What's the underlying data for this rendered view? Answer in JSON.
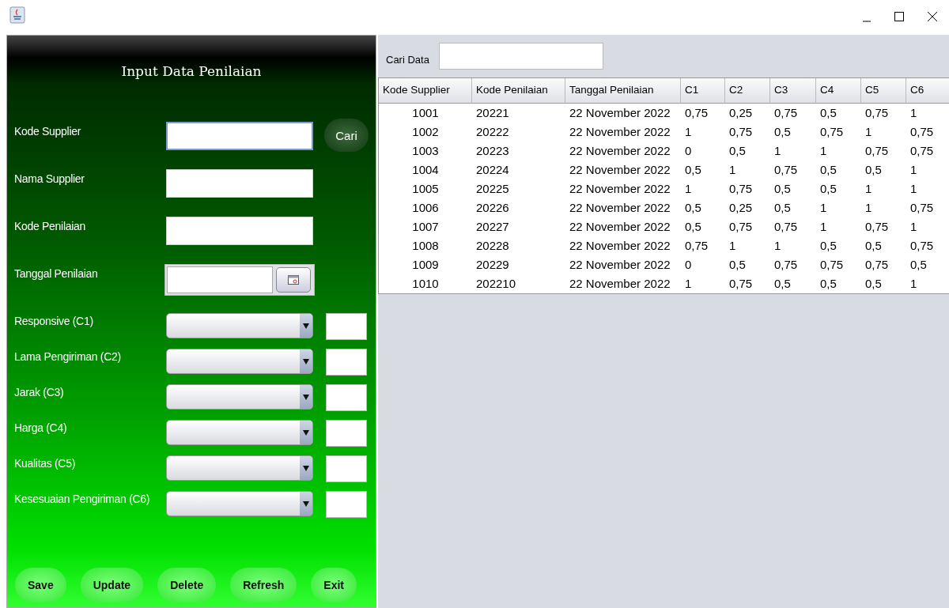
{
  "form": {
    "title": "Input Data Penilaian",
    "fields": [
      {
        "kind": "text",
        "label": "Kode Supplier",
        "focused": true,
        "action": "Cari"
      },
      {
        "kind": "text",
        "label": "Nama Supplier",
        "focused": false
      },
      {
        "kind": "text",
        "label": "Kode Penilaian",
        "focused": false
      },
      {
        "kind": "date",
        "label": "Tanggal Penilaian",
        "focused": false
      },
      {
        "kind": "combo",
        "label": "Responsive (C1)",
        "focused": false
      },
      {
        "kind": "combo",
        "label": "Lama Pengiriman (C2)",
        "focused": false
      },
      {
        "kind": "combo",
        "label": "Jarak (C3)",
        "focused": false
      },
      {
        "kind": "combo",
        "label": "Harga (C4)",
        "focused": false
      },
      {
        "kind": "combo",
        "label": "Kualitas (C5)",
        "focused": false
      },
      {
        "kind": "combo",
        "label": "Kesesuaian Pengiriman (C6)",
        "focused": false
      }
    ],
    "buttons": [
      "Save",
      "Update",
      "Delete",
      "Refresh",
      "Exit"
    ]
  },
  "search": {
    "label": "Cari Data"
  },
  "table": {
    "columns": [
      "Kode Supplier",
      "Kode Penilaian",
      "Tanggal Penilaian",
      "C1",
      "C2",
      "C3",
      "C4",
      "C5",
      "C6"
    ],
    "rows": [
      [
        "1001",
        "20221",
        "22 November 2022",
        "0,75",
        "0,25",
        "0,75",
        "0,5",
        "0,75",
        "1"
      ],
      [
        "1002",
        "20222",
        "22 November 2022",
        "1",
        "0,75",
        "0,5",
        "0,75",
        "1",
        "0,75"
      ],
      [
        "1003",
        "20223",
        "22 November 2022",
        "0",
        "0,5",
        "1",
        "1",
        "0,75",
        "0,75"
      ],
      [
        "1004",
        "20224",
        "22 November 2022",
        "0,5",
        "1",
        "0,75",
        "0,5",
        "0,5",
        "1"
      ],
      [
        "1005",
        "20225",
        "22 November 2022",
        "1",
        "0,75",
        "0,5",
        "0,5",
        "1",
        "1"
      ],
      [
        "1006",
        "20226",
        "22 November 2022",
        "0,5",
        "0,25",
        "0,5",
        "1",
        "1",
        "0,75"
      ],
      [
        "1007",
        "20227",
        "22 November 2022",
        "0,5",
        "0,75",
        "0,75",
        "1",
        "0,75",
        "1"
      ],
      [
        "1008",
        "20228",
        "22 November 2022",
        "0,75",
        "1",
        "1",
        "0,5",
        "0,5",
        "0,75"
      ],
      [
        "1009",
        "20229",
        "22 November 2022",
        "0",
        "0,5",
        "0,75",
        "0,75",
        "0,75",
        "0,5"
      ],
      [
        "1010",
        "202210",
        "22 November 2022",
        "1",
        "0,75",
        "0,5",
        "0,5",
        "0,5",
        "1"
      ]
    ]
  }
}
